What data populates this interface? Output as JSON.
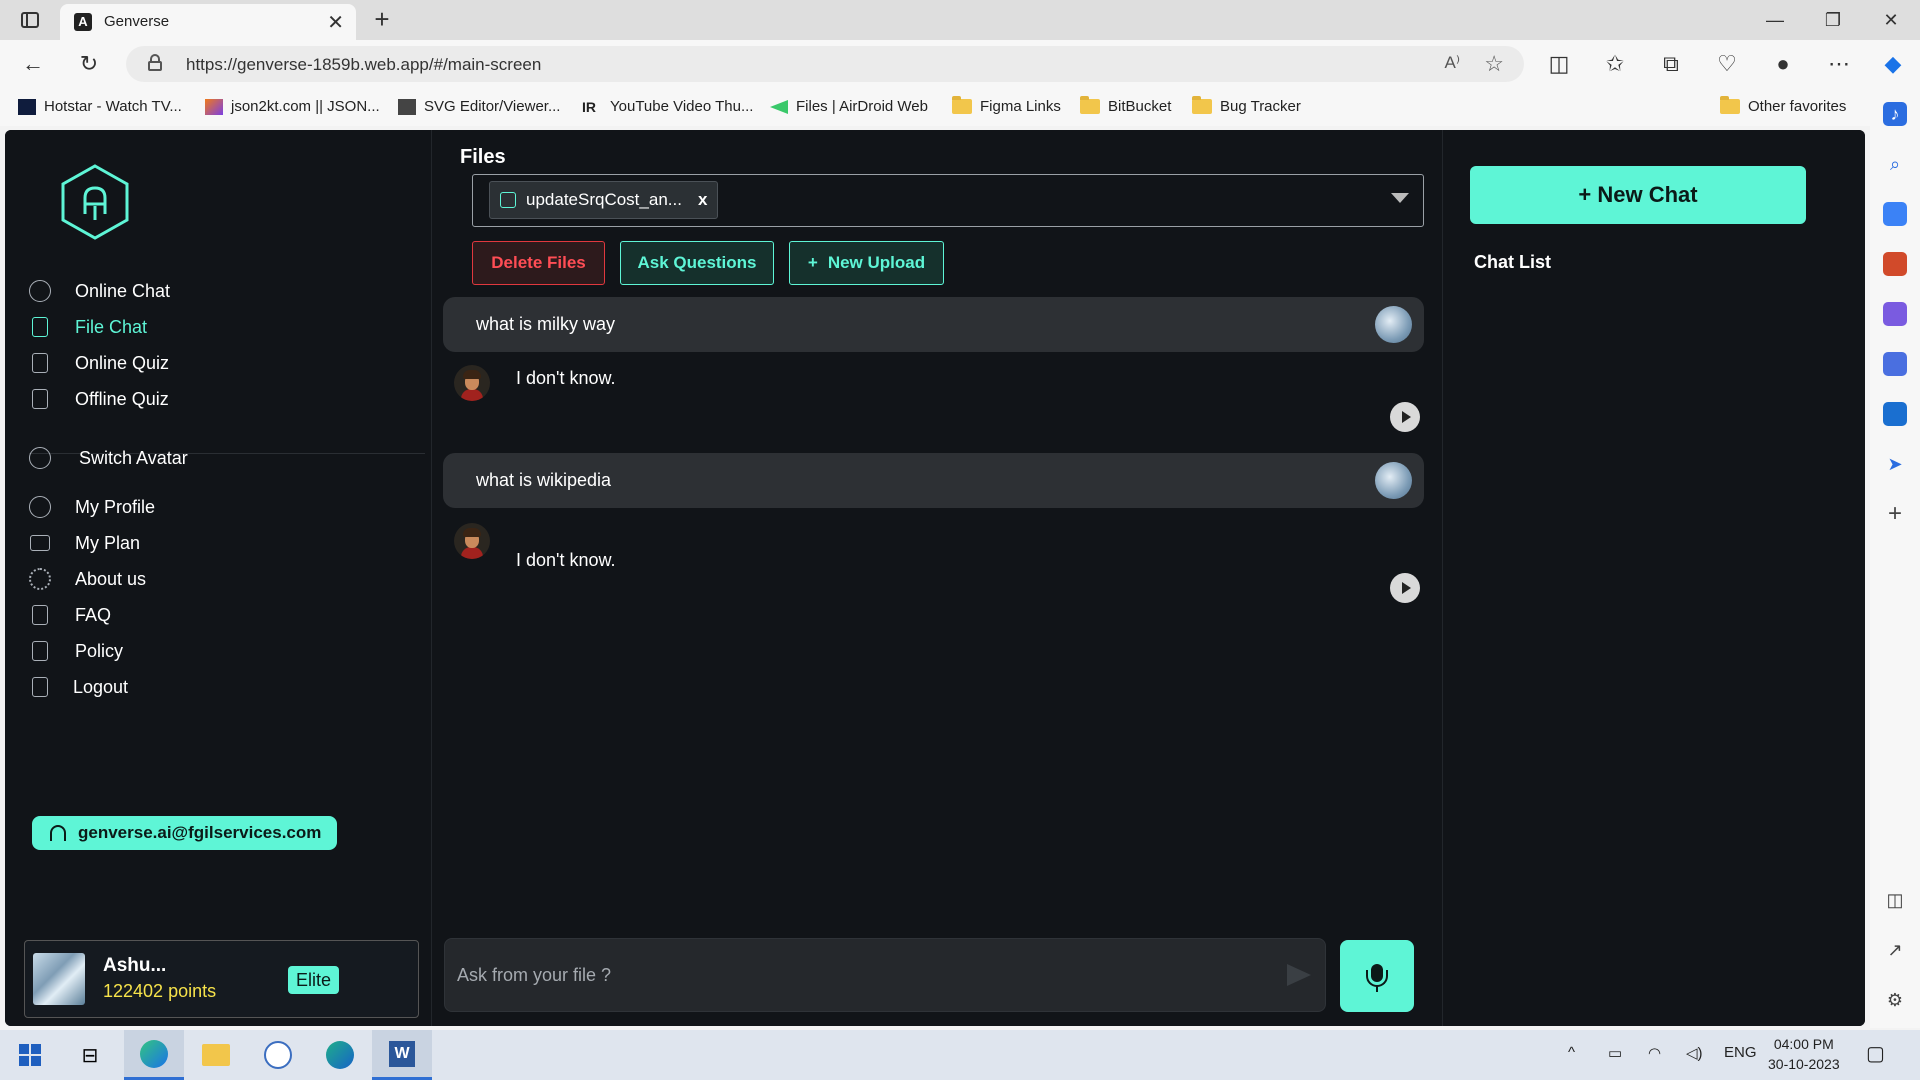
{
  "browser": {
    "tab_title": "Genverse",
    "tab_favicon": "A",
    "url": "https://genverse-1859b.web.app/#/main-screen",
    "bookmarks": [
      {
        "label": "Hotstar - Watch TV...",
        "icon": "hotstar-icon"
      },
      {
        "label": "json2kt.com || JSON...",
        "icon": "json2kt-icon"
      },
      {
        "label": "SVG Editor/Viewer...",
        "icon": "svg-editor-icon"
      },
      {
        "label": "YouTube Video Thu...",
        "icon": "ir-icon"
      },
      {
        "label": "Files | AirDroid Web",
        "icon": "airdroid-icon"
      },
      {
        "label": "Figma Links",
        "icon": "folder-icon"
      },
      {
        "label": "BitBucket",
        "icon": "folder-icon"
      },
      {
        "label": "Bug Tracker",
        "icon": "folder-icon"
      }
    ],
    "other_favorites": "Other favorites"
  },
  "sidebar": {
    "items": [
      {
        "label": "Online Chat",
        "icon": "chat-bubble-icon"
      },
      {
        "label": "File Chat",
        "icon": "file-upload-icon"
      },
      {
        "label": "Online Quiz",
        "icon": "document-icon"
      },
      {
        "label": "Offline Quiz",
        "icon": "document-plus-icon"
      },
      {
        "label": "Switch Avatar",
        "icon": "users-icon"
      },
      {
        "label": "My Profile",
        "icon": "user-icon"
      },
      {
        "label": "My Plan",
        "icon": "ticket-icon"
      },
      {
        "label": "About us",
        "icon": "gear-icon"
      },
      {
        "label": "FAQ",
        "icon": "list-icon"
      },
      {
        "label": "Policy",
        "icon": "list-icon"
      },
      {
        "label": "Logout",
        "icon": "logout-icon"
      }
    ],
    "support_email": "genverse.ai@fgilservices.com",
    "user": {
      "name": "Ashu...",
      "points": "122402 points",
      "badge": "Elite"
    }
  },
  "files": {
    "title": "Files",
    "selected_file": "updateSrqCost_an...",
    "remove_label": "x",
    "delete_label": "Delete Files",
    "ask_label": "Ask Questions",
    "upload_label": "New Upload",
    "upload_prefix": "+"
  },
  "chat": {
    "messages": [
      {
        "question": "what is milky way",
        "answer": "I don't know."
      },
      {
        "question": "what is wikipedia",
        "answer": "I don't know."
      }
    ],
    "input_placeholder": "Ask from your file ?"
  },
  "right_panel": {
    "new_chat_label": "+ New Chat",
    "chat_list_title": "Chat List"
  },
  "taskbar": {
    "language": "ENG",
    "time": "04:00 PM",
    "date": "30-10-2023"
  },
  "colors": {
    "accent": "#5ef5d6",
    "danger": "#ff4d55",
    "points": "#f6e24a",
    "app_bg": "#111418"
  }
}
